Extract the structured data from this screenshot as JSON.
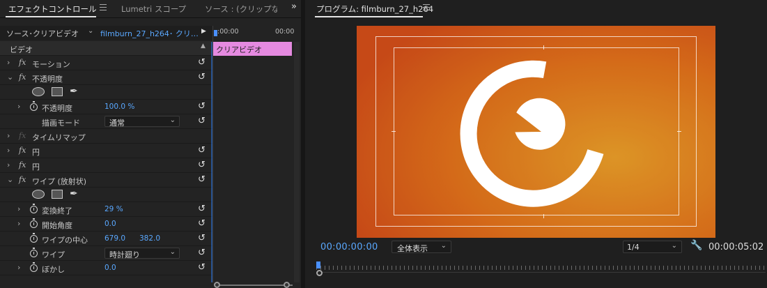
{
  "left_panel": {
    "tabs": [
      {
        "label": "エフェクトコントロール",
        "active": true
      },
      {
        "label": "Lumetri スコープ",
        "active": false
      },
      {
        "label": "ソース : (クリップなし",
        "active": false
      }
    ],
    "more_icon": "double-chevron-right-icon",
    "source_label": "ソース･クリアビデオ",
    "clip_name": "filmburn_27_h264･ クリ…",
    "timeline": {
      "time_start": ":00:00",
      "time_end": "00:00",
      "clip_label": "クリアビデオ"
    },
    "section_header": "ビデオ",
    "properties": [
      {
        "label": "モーション",
        "type": "effect"
      },
      {
        "label": "不透明度",
        "type": "effect"
      },
      {
        "label": "不透明度",
        "type": "param",
        "value": "100.0 %"
      },
      {
        "label": "描画モード",
        "type": "param",
        "value": "通常"
      },
      {
        "label": "タイムリマップ",
        "type": "effect"
      },
      {
        "label": "円",
        "type": "effect"
      },
      {
        "label": "円",
        "type": "effect"
      },
      {
        "label": "ワイプ (放射状)",
        "type": "effect"
      },
      {
        "label": "変換終了",
        "type": "param",
        "value": "29 %"
      },
      {
        "label": "開始角度",
        "type": "param",
        "value": "0.0"
      },
      {
        "label": "ワイプの中心",
        "type": "param",
        "value_x": "679.0",
        "value_y": "382.0"
      },
      {
        "label": "ワイプ",
        "type": "param",
        "value": "時計廻り"
      },
      {
        "label": "ぼかし",
        "type": "param",
        "value": "0.0"
      }
    ]
  },
  "program_monitor": {
    "title": "プログラム: filmburn_27_h264",
    "timecode_current": "00:00:00:00",
    "zoom": "全体表示",
    "resolution": "1/4",
    "timecode_duration": "00:00:05:02",
    "settings_icon": "wrench-icon"
  },
  "colors": {
    "accent_blue": "#5aa8ff",
    "clip_pink": "#e58ae0",
    "frame_orange": "#e8641a"
  }
}
